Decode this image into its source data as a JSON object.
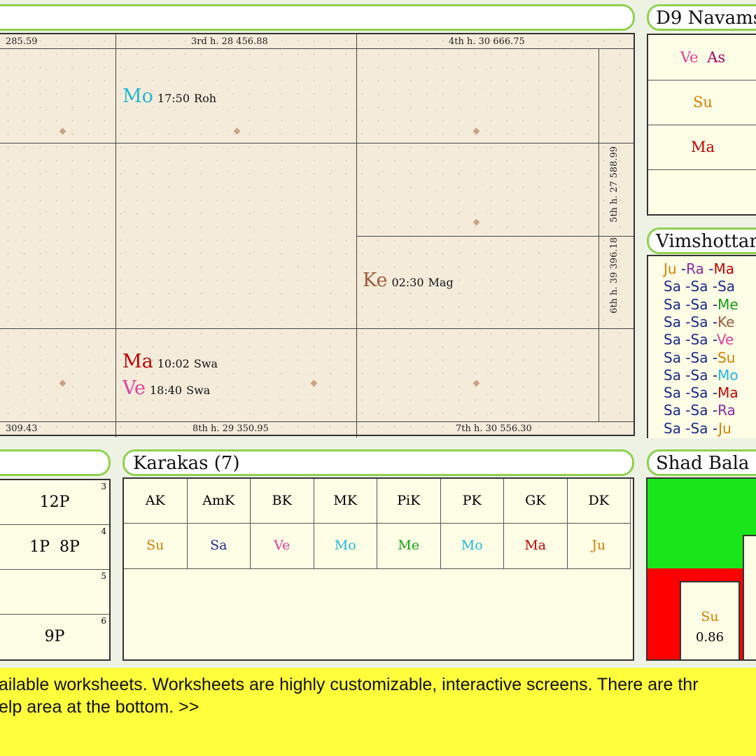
{
  "chart": {
    "top_labels": [
      "285.59",
      "3rd h.  28  456.88",
      "4th h.  30  666.75"
    ],
    "bottom_labels": [
      "309.43",
      "8th h.  29  350.95",
      "7th h.  30  556.30"
    ],
    "side_labels": [
      "5th h.  27  588.99",
      "6th h.  39  396.18"
    ],
    "planets": [
      {
        "name": "Mo",
        "time": "17:50",
        "nak": "Roh",
        "color": "#1fb8d8"
      },
      {
        "name": "Ke",
        "time": "02:30",
        "nak": "Mag",
        "color": "#9c5a3c"
      },
      {
        "name": "Ma",
        "time": "10:02",
        "nak": "Swa",
        "color": "#c00000"
      },
      {
        "name": "Ve",
        "time": "18:40",
        "nak": "Swa",
        "color": "#e0409a"
      }
    ]
  },
  "d9": {
    "title": "D9 Navams",
    "row1": {
      "a": "Ve",
      "b": "As"
    },
    "row2": "Su",
    "row3": "Ma",
    "colors": {
      "Ve": "#e0409a",
      "As": "#a00060",
      "Su": "#d08000",
      "Ma": "#c00000"
    }
  },
  "vimshottari": {
    "title": "Vimshottari",
    "rows": [
      [
        {
          "t": "Ju",
          "c": "#d08000"
        },
        {
          "t": "Ra",
          "c": "#8a2ba0"
        },
        {
          "t": "Ma",
          "c": "#c00000"
        }
      ],
      [
        {
          "t": "Sa",
          "c": "#1a2a8a"
        },
        {
          "t": "Sa",
          "c": "#1a2a8a"
        },
        {
          "t": "Sa",
          "c": "#1a2a8a"
        }
      ],
      [
        {
          "t": "Sa",
          "c": "#1a2a8a"
        },
        {
          "t": "Sa",
          "c": "#1a2a8a"
        },
        {
          "t": "Me",
          "c": "#10a010"
        }
      ],
      [
        {
          "t": "Sa",
          "c": "#1a2a8a"
        },
        {
          "t": "Sa",
          "c": "#1a2a8a"
        },
        {
          "t": "Ke",
          "c": "#9c5a3c"
        }
      ],
      [
        {
          "t": "Sa",
          "c": "#1a2a8a"
        },
        {
          "t": "Sa",
          "c": "#1a2a8a"
        },
        {
          "t": "Ve",
          "c": "#e0409a"
        }
      ],
      [
        {
          "t": "Sa",
          "c": "#1a2a8a"
        },
        {
          "t": "Sa",
          "c": "#1a2a8a"
        },
        {
          "t": "Su",
          "c": "#d08000"
        }
      ],
      [
        {
          "t": "Sa",
          "c": "#1a2a8a"
        },
        {
          "t": "Sa",
          "c": "#1a2a8a"
        },
        {
          "t": "Mo",
          "c": "#1fb8d8"
        }
      ],
      [
        {
          "t": "Sa",
          "c": "#1a2a8a"
        },
        {
          "t": "Sa",
          "c": "#1a2a8a"
        },
        {
          "t": "Ma",
          "c": "#c00000"
        }
      ],
      [
        {
          "t": "Sa",
          "c": "#1a2a8a"
        },
        {
          "t": "Sa",
          "c": "#1a2a8a"
        },
        {
          "t": "Ra",
          "c": "#8a2ba0"
        }
      ],
      [
        {
          "t": "Sa",
          "c": "#1a2a8a"
        },
        {
          "t": "Sa",
          "c": "#1a2a8a"
        },
        {
          "t": "Ju",
          "c": "#d08000"
        }
      ]
    ]
  },
  "left_table": {
    "rows": [
      {
        "num": "3",
        "text": "12P"
      },
      {
        "num": "4",
        "text": "1P  8P"
      },
      {
        "num": "5",
        "text": ""
      },
      {
        "num": "6",
        "text": "9P"
      }
    ]
  },
  "karakas": {
    "title": "Karakas (7)",
    "headers": [
      "AK",
      "AmK",
      "BK",
      "MK",
      "PiK",
      "PK",
      "GK",
      "DK"
    ],
    "values": [
      {
        "t": "Su",
        "c": "#d08000"
      },
      {
        "t": "Sa",
        "c": "#1a2a8a"
      },
      {
        "t": "Ve",
        "c": "#e0409a"
      },
      {
        "t": "Mo",
        "c": "#1fb8d8"
      },
      {
        "t": "Me",
        "c": "#10a010"
      },
      {
        "t": "Mo",
        "c": "#1fb8d8"
      },
      {
        "t": "Ma",
        "c": "#c00000"
      },
      {
        "t": "Ju",
        "c": "#d08000"
      }
    ]
  },
  "shad_bala": {
    "title": "Shad Bala",
    "planet": "Su",
    "value": "0.86"
  },
  "help": {
    "line1": "ailable worksheets. Worksheets are highly customizable, interactive screens. There are thr",
    "line2": "elp area at the bottom. >>"
  }
}
